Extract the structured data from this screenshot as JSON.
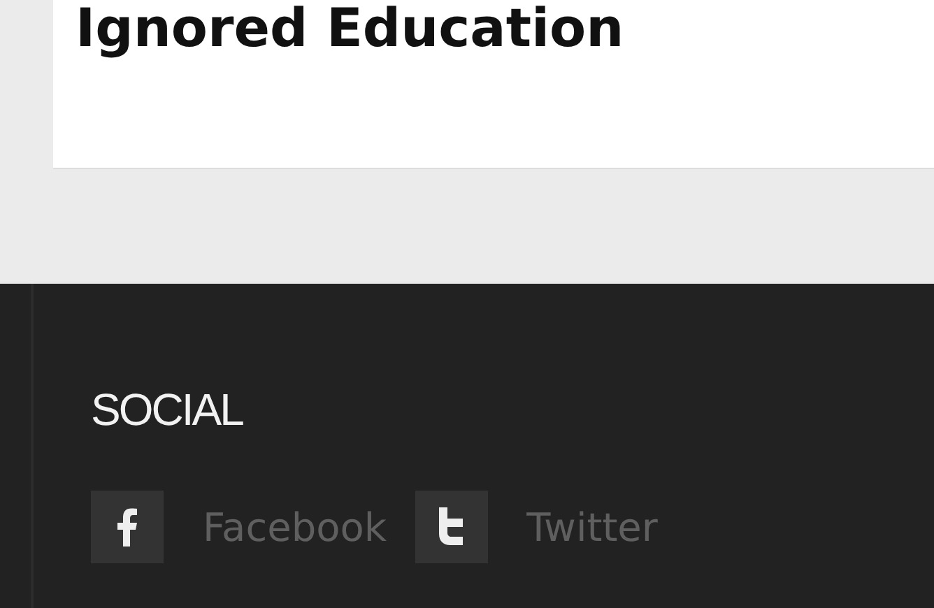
{
  "article": {
    "title": "Ignored Education"
  },
  "footer": {
    "heading": "SOCIAL",
    "links": [
      {
        "kind": "facebook",
        "label": "Facebook"
      },
      {
        "kind": "twitter",
        "label": "Twitter"
      }
    ]
  }
}
